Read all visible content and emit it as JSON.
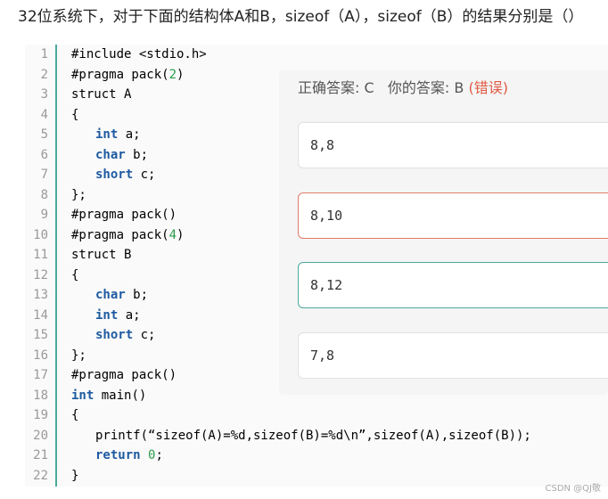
{
  "question": "32位系统下，对于下面的结构体A和B，sizeof（A），sizeof（B）的结果分别是（）",
  "code": {
    "line_numbers": [
      "1",
      "2",
      "3",
      "4",
      "5",
      "6",
      "7",
      "8",
      "9",
      "10",
      "11",
      "12",
      "13",
      "14",
      "15",
      "16",
      "17",
      "18",
      "19",
      "20",
      "21",
      "22"
    ],
    "lines": {
      "l1": "#include <stdio.h>",
      "l2a": "#pragma pack(",
      "l2b": "2",
      "l2c": ")",
      "l3": "struct A",
      "l4": "{",
      "l5a": "int",
      "l5b": " a;",
      "l6a": "char",
      "l6b": " b;",
      "l7a": "short",
      "l7b": " c;",
      "l8": "};",
      "l9": "#pragma pack()",
      "l10a": "#pragma pack(",
      "l10b": "4",
      "l10c": ")",
      "l11": "struct B",
      "l12": "{",
      "l13a": "char",
      "l13b": " b;",
      "l14a": "int",
      "l14b": " a;",
      "l15a": "short",
      "l15b": " c;",
      "l16": "};",
      "l17": "#pragma pack()",
      "l18a": "int",
      "l18b": " main()",
      "l19": "{",
      "l20": "printf(“sizeof(A)=%d,sizeof(B)=%d\\n”,sizeof(A),sizeof(B));",
      "l21a": "return",
      "l21b": " ",
      "l21c": "0",
      "l21d": ";",
      "l22": "}"
    }
  },
  "answer": {
    "correct_label": "正确答案: C",
    "yours_label": "你的答案: B",
    "wrong_tag": "(错误)",
    "options": [
      "8,8",
      "8,10",
      "8,12",
      "7,8"
    ]
  },
  "colors": {
    "keyword": "#1e5aa0",
    "number": "#2a9d4a",
    "wrong": "#e05a44",
    "correct_border": "#4aa99c"
  },
  "watermark": "CSDN @QJ敬"
}
